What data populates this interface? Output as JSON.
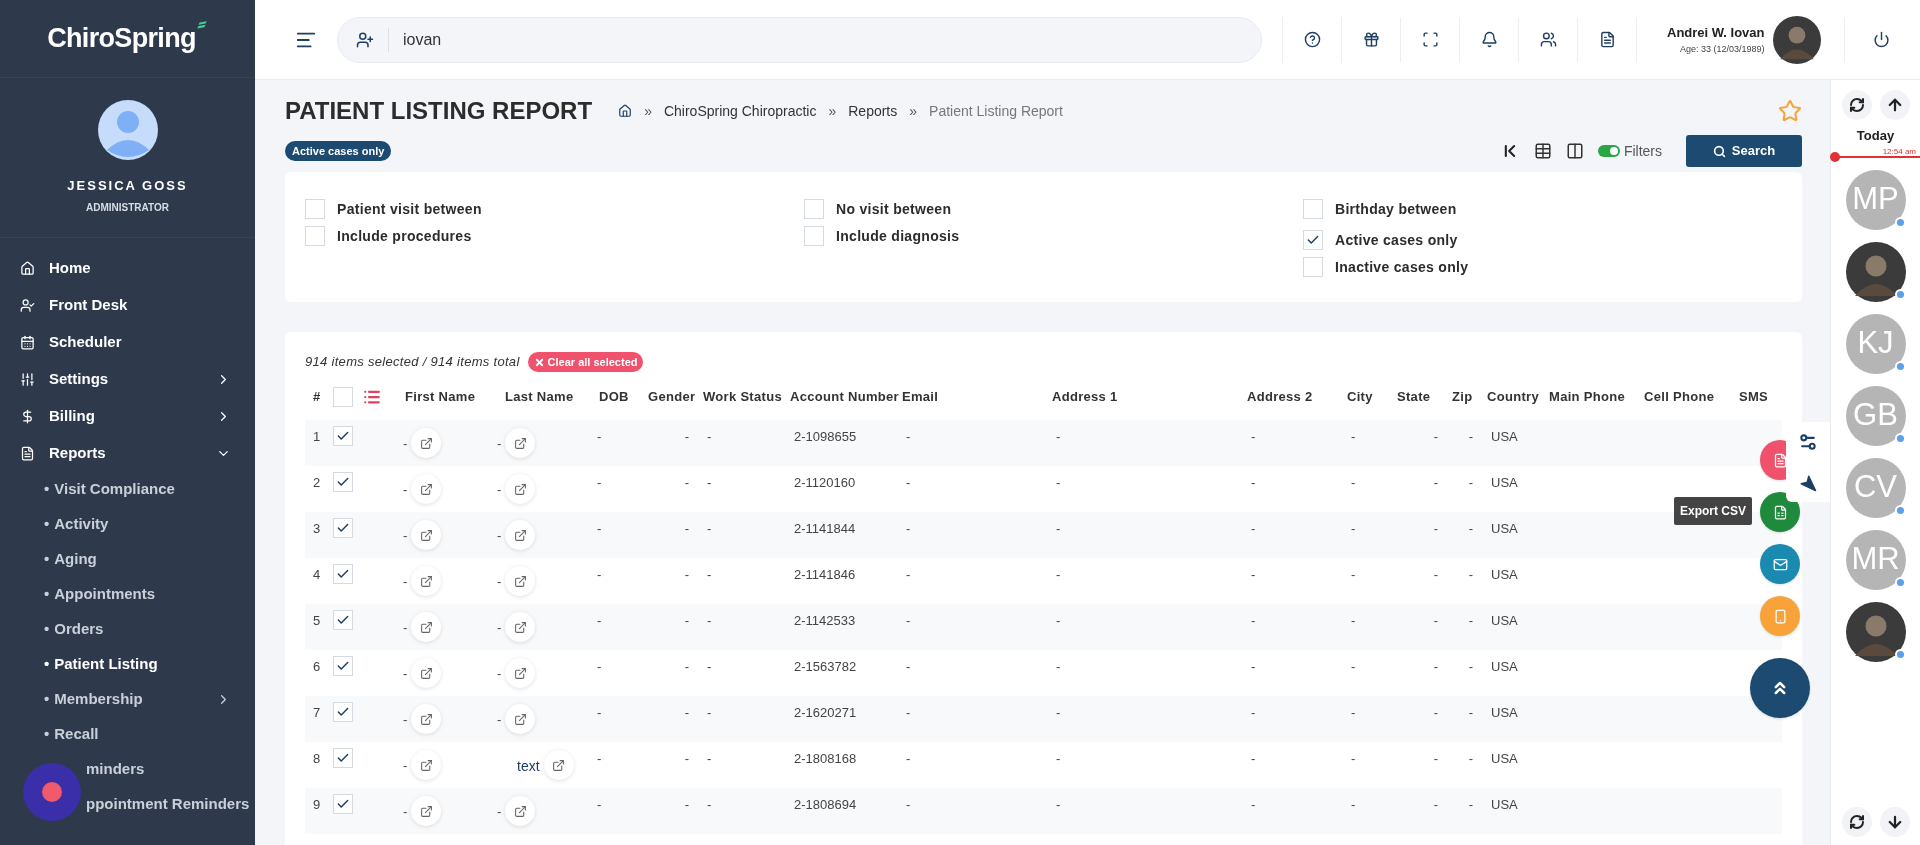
{
  "brand": "ChiroSpring",
  "user": {
    "name": "JESSICA GOSS",
    "role": "ADMINISTRATOR"
  },
  "nav": [
    {
      "label": "Home"
    },
    {
      "label": "Front Desk"
    },
    {
      "label": "Scheduler"
    },
    {
      "label": "Settings",
      "expanded": false
    },
    {
      "label": "Billing",
      "expanded": false
    },
    {
      "label": "Reports",
      "expanded": true,
      "children": [
        {
          "bullet": "•",
          "label": "Visit Compliance",
          "selected": false
        },
        {
          "bullet": "•",
          "label": "Activity",
          "selected": false
        },
        {
          "bullet": "•",
          "label": "Aging",
          "selected": false
        },
        {
          "bullet": "•",
          "label": "Appointments",
          "selected": false
        },
        {
          "bullet": "•",
          "label": "Orders",
          "selected": false
        },
        {
          "bullet": "•",
          "label": "Patient Listing",
          "selected": true
        },
        {
          "bullet": "•",
          "label": "Membership",
          "selected": false,
          "expanded": false
        },
        {
          "bullet": "•",
          "label": "Recall",
          "selected": false
        },
        {
          "label": "minders",
          "selected": false
        },
        {
          "label": "ppointment Reminders",
          "selected": false
        }
      ]
    }
  ],
  "search": {
    "value": "iovan"
  },
  "header_user": {
    "name": "Andrei W. Iovan",
    "detail": "Age: 33 (12/03/1989)"
  },
  "page": {
    "title": "PATIENT LISTING REPORT",
    "favorite": false,
    "breadcrumb": [
      {
        "separator": "»",
        "label": "ChiroSpring Chiropractic",
        "selected": false
      },
      {
        "separator": "»",
        "label": "Reports",
        "selected": false
      },
      {
        "separator": "»",
        "label": "Patient Listing Report",
        "selected": true
      }
    ],
    "tag": "Active cases only"
  },
  "toolbar": {
    "filters_label": "Filters",
    "filters_on": true,
    "search_label": "Search"
  },
  "filters": [
    [
      {
        "label": "Patient visit between",
        "checked": false
      },
      {
        "label": "Include procedures",
        "checked": false
      }
    ],
    [
      {
        "label": "No visit between",
        "checked": false
      },
      {
        "label": "Include diagnosis",
        "checked": false
      }
    ],
    [
      {
        "label": "Birthday between",
        "checked": false
      },
      {
        "label": "Active cases only",
        "checked": true
      },
      {
        "label": "Inactive cases only",
        "checked": false
      }
    ]
  ],
  "table": {
    "summary": "914 items selected / 914 items total",
    "clear_label": "Clear all selected",
    "header_number": "#",
    "header_checked": false,
    "columns": [
      "First Name",
      "Last Name",
      "DOB",
      "Gender",
      "Work Status",
      "Account Number",
      "Email",
      "Address 1",
      "Address 2",
      "City",
      "State",
      "Zip",
      "Country",
      "Main Phone",
      "Cell Phone",
      "SMS"
    ],
    "rows": [
      {
        "number": "1",
        "checked": true,
        "cells": [
          "-",
          "-",
          "-",
          "-",
          "-",
          "2-1098655",
          "-",
          "-",
          "-",
          "-",
          "-",
          "-",
          "USA"
        ]
      },
      {
        "number": "2",
        "checked": true,
        "cells": [
          "-",
          "-",
          "-",
          "-",
          "-",
          "2-1120160",
          "-",
          "-",
          "-",
          "-",
          "-",
          "-",
          "USA"
        ]
      },
      {
        "number": "3",
        "checked": true,
        "cells": [
          "-",
          "-",
          "-",
          "-",
          "-",
          "2-1141844",
          "-",
          "-",
          "-",
          "-",
          "-",
          "-",
          "USA"
        ]
      },
      {
        "number": "4",
        "checked": true,
        "cells": [
          "-",
          "-",
          "-",
          "-",
          "-",
          "2-1141846",
          "-",
          "-",
          "-",
          "-",
          "-",
          "-",
          "USA"
        ]
      },
      {
        "number": "5",
        "checked": true,
        "cells": [
          "-",
          "-",
          "-",
          "-",
          "-",
          "2-1142533",
          "-",
          "-",
          "-",
          "-",
          "-",
          "-",
          "USA"
        ]
      },
      {
        "number": "6",
        "checked": true,
        "cells": [
          "-",
          "-",
          "-",
          "-",
          "-",
          "2-1563782",
          "-",
          "-",
          "-",
          "-",
          "-",
          "-",
          "USA"
        ]
      },
      {
        "number": "7",
        "checked": true,
        "cells": [
          "-",
          "-",
          "-",
          "-",
          "-",
          "2-1620271",
          "-",
          "-",
          "-",
          "-",
          "-",
          "-",
          "USA"
        ]
      },
      {
        "number": "8",
        "checked": true,
        "cells": [
          "-",
          "text",
          "-",
          "-",
          "-",
          "2-1808168",
          "-",
          "-",
          "-",
          "-",
          "-",
          "-",
          "USA"
        ]
      },
      {
        "number": "9",
        "checked": true,
        "cells": [
          "-",
          "-",
          "-",
          "-",
          "-",
          "2-1808694",
          "-",
          "-",
          "-",
          "-",
          "-",
          "-",
          "USA"
        ]
      }
    ]
  },
  "actions": [
    {
      "kind": "pdf"
    },
    {
      "kind": "csv",
      "tooltip": "Export CSV"
    },
    {
      "kind": "email"
    },
    {
      "kind": "mobile"
    }
  ],
  "rail": {
    "day": "Today",
    "time": "12:54 am",
    "people": [
      {
        "kind": "initials",
        "initials": "MP"
      },
      {
        "kind": "photo"
      },
      {
        "kind": "initials",
        "initials": "KJ"
      },
      {
        "kind": "initials",
        "initials": "GB"
      },
      {
        "kind": "initials",
        "initials": "CV"
      },
      {
        "kind": "initials",
        "initials": "MR"
      },
      {
        "kind": "photo"
      }
    ]
  }
}
